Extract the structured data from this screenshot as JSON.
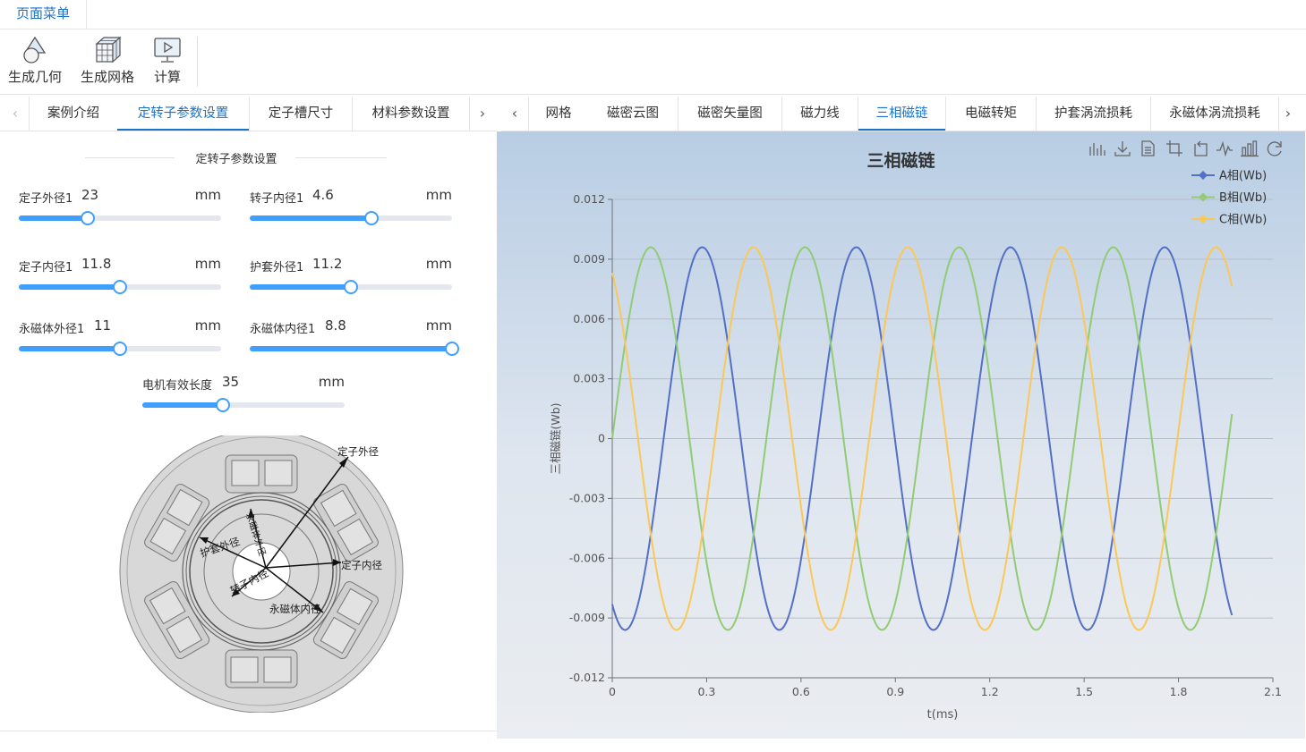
{
  "menu": {
    "label": "页面菜单"
  },
  "toolbar": {
    "items": [
      {
        "label": "生成几何",
        "icon": "geometry-icon"
      },
      {
        "label": "生成网格",
        "icon": "mesh-icon"
      },
      {
        "label": "计算",
        "icon": "compute-icon"
      }
    ]
  },
  "left_tabs": [
    "案例介绍",
    "定转子参数设置",
    "定子槽尺寸",
    "材料参数设置"
  ],
  "left_tabs_active": 1,
  "right_tabs": [
    "网格",
    "磁密云图",
    "磁密矢量图",
    "磁力线",
    "三相磁链",
    "电磁转矩",
    "护套涡流损耗",
    "永磁体涡流损耗"
  ],
  "right_tabs_active": 4,
  "section_title": "定转子参数设置",
  "params": [
    {
      "label": "定子外径1",
      "value": "23",
      "unit": "mm",
      "level": 0.34
    },
    {
      "label": "转子内径1",
      "value": "4.6",
      "unit": "mm",
      "level": 0.6
    },
    {
      "label": "定子内径1",
      "value": "11.8",
      "unit": "mm",
      "level": 0.5
    },
    {
      "label": "护套外径1",
      "value": "11.2",
      "unit": "mm",
      "level": 0.5
    },
    {
      "label": "永磁体外径1",
      "value": "11",
      "unit": "mm",
      "level": 0.5
    },
    {
      "label": "永磁体内径1",
      "value": "8.8",
      "unit": "mm",
      "level": 1.0
    },
    {
      "label": "电机有效长度",
      "value": "35",
      "unit": "mm",
      "level": 0.4
    }
  ],
  "diagram_labels": {
    "stator_outer": "定子外径",
    "stator_inner": "定子内径",
    "sleeve_outer": "护套外径",
    "rotor_inner": "转子内径",
    "magnet_inner": "永磁体内径",
    "magnet_outer": "永磁体外径"
  },
  "chart_tools": [
    "data-zoom-icon",
    "download-icon",
    "data-view-icon",
    "zoom-icon",
    "zoom-reset-icon",
    "line-chart-icon",
    "bar-chart-icon",
    "refresh-icon"
  ],
  "chart_data": {
    "type": "line",
    "title": "三相磁链",
    "xlabel": "t(ms)",
    "ylabel": "三相磁链(Wb)",
    "xlim": [
      0,
      2.1
    ],
    "ylim": [
      -0.012,
      0.012
    ],
    "xticks": [
      "0",
      "0.3",
      "0.6",
      "0.9",
      "1.2",
      "1.5",
      "1.8",
      "2.1"
    ],
    "yticks": [
      "0.012",
      "0.009",
      "0.006",
      "0.003",
      "0",
      "-0.003",
      "-0.006",
      "-0.009",
      "-0.012"
    ],
    "legend_position": "top-right",
    "x_end": 1.97,
    "period": 0.49,
    "amplitude": 0.0096,
    "series": [
      {
        "name": "A相(Wb)",
        "color": "#5470c6",
        "phase_shift_deg": -120
      },
      {
        "name": "B相(Wb)",
        "color": "#91cc75",
        "phase_shift_deg": 0
      },
      {
        "name": "C相(Wb)",
        "color": "#fac858",
        "phase_shift_deg": 120
      }
    ]
  }
}
